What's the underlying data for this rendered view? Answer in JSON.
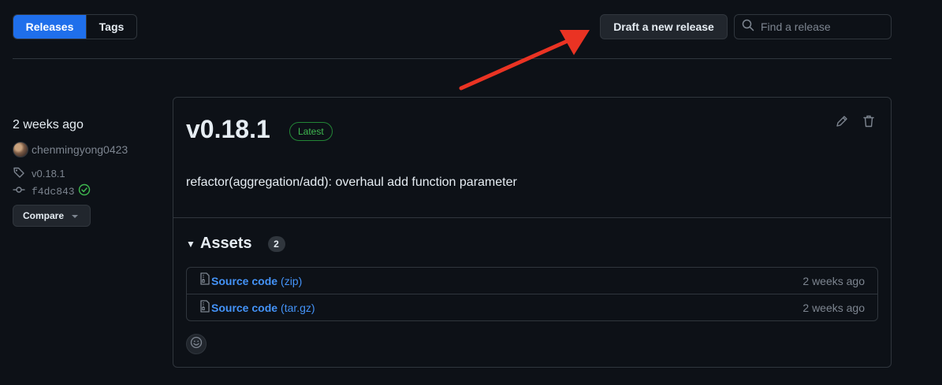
{
  "nav": {
    "releases_label": "Releases",
    "tags_label": "Tags",
    "draft_label": "Draft a new release",
    "search_placeholder": "Find a release"
  },
  "meta": {
    "time": "2 weeks ago",
    "author": "chenmingyong0423",
    "tag": "v0.18.1",
    "commit": "f4dc843",
    "compare_label": "Compare"
  },
  "release": {
    "title": "v0.18.1",
    "badge": "Latest",
    "body": "refactor(aggregation/add): overhaul add function parameter"
  },
  "assets": {
    "title": "Assets",
    "count": "2",
    "items": [
      {
        "label": "Source code",
        "ext": "(zip)",
        "time": "2 weeks ago"
      },
      {
        "label": "Source code",
        "ext": "(tar.gz)",
        "time": "2 weeks ago"
      }
    ]
  },
  "colors": {
    "background": "#0d1117",
    "accent": "#1f6feb",
    "link": "#4493f8",
    "success": "#3fb950",
    "annotation_arrow": "#ea3323"
  },
  "icons": [
    "search-icon",
    "tag-icon",
    "commit-icon",
    "check-circle-icon",
    "pencil-icon",
    "trash-icon",
    "file-zip-icon",
    "smiley-icon",
    "triangle-down-icon"
  ]
}
